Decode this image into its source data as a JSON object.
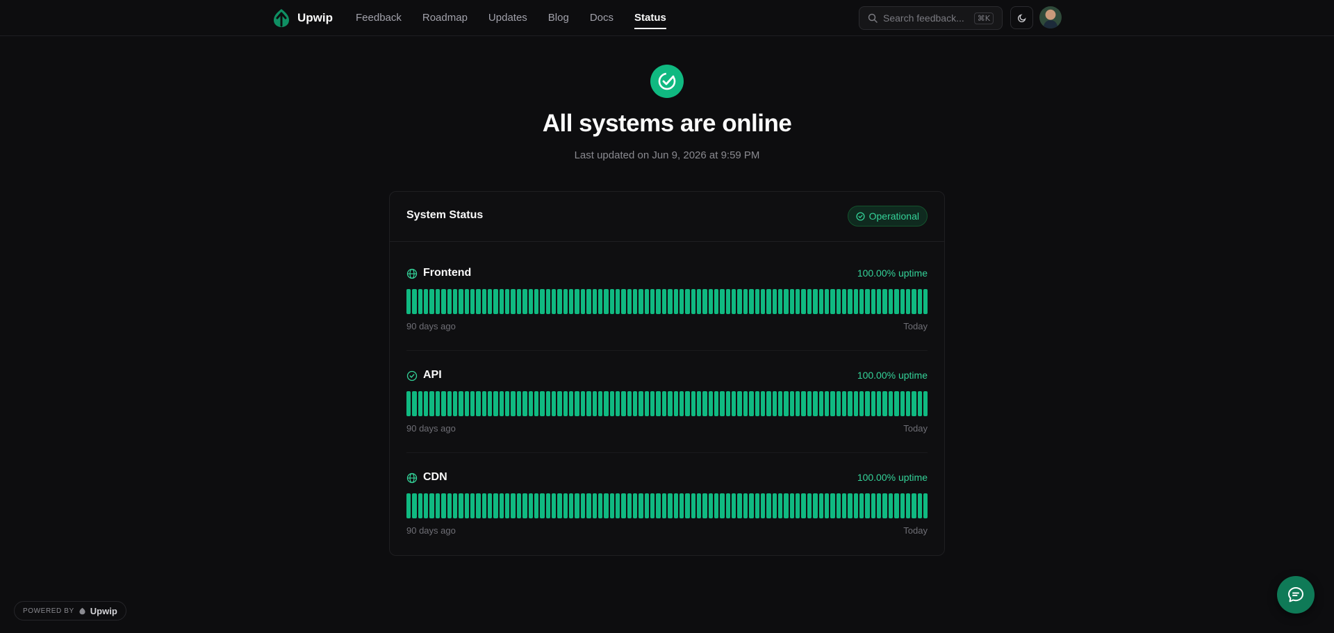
{
  "brand": {
    "name": "Upwip",
    "accent": "#10b981"
  },
  "nav": {
    "links": [
      {
        "label": "Feedback"
      },
      {
        "label": "Roadmap"
      },
      {
        "label": "Updates"
      },
      {
        "label": "Blog"
      },
      {
        "label": "Docs"
      },
      {
        "label": "Status",
        "active": true
      }
    ],
    "search_placeholder": "Search feedback...",
    "search_shortcut": "⌘K",
    "theme_icon": "moon-icon"
  },
  "hero": {
    "title": "All systems are online",
    "subtitle": "Last updated on Jun 9, 2026 at 9:59 PM"
  },
  "card": {
    "title": "System Status",
    "badge": "Operational"
  },
  "services": [
    {
      "name": "Frontend",
      "icon": "globe-icon",
      "uptime": "100.00% uptime",
      "start_label": "90 days ago",
      "end_label": "Today"
    },
    {
      "name": "API",
      "icon": "check-circle-icon",
      "uptime": "100.00% uptime",
      "start_label": "90 days ago",
      "end_label": "Today"
    },
    {
      "name": "CDN",
      "icon": "globe-icon",
      "uptime": "100.00% uptime",
      "start_label": "90 days ago",
      "end_label": "Today"
    }
  ],
  "footer": {
    "powered_by": "POWERED BY",
    "powered_brand": "Upwip"
  }
}
